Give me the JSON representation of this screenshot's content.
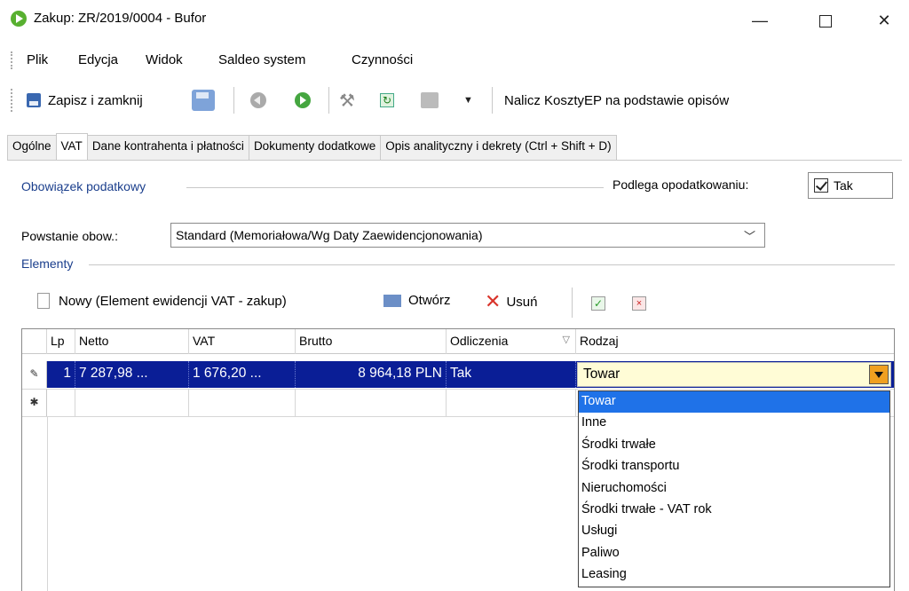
{
  "window": {
    "title": "Zakup: ZR/2019/0004 - Bufor",
    "minimize_glyph": "—",
    "close_glyph": "✕"
  },
  "menu": [
    "Plik",
    "Edycja",
    "Widok",
    "Saldeo system",
    "Czynności"
  ],
  "toolbar": {
    "save_close_label": "Zapisz i zamknij",
    "calc_label": "Nalicz KosztyEP na podstawie opisów",
    "dropdown_glyph": "▼",
    "refresh_glyph": "↻",
    "tools_glyph": "⚒"
  },
  "tabs": [
    "Ogólne",
    "VAT",
    "Dane kontrahenta i płatności",
    "Dokumenty dodatkowe",
    "Opis analityczny i dekrety (Ctrl + Shift + D)"
  ],
  "vat": {
    "obligation_section": "Obowiązek podatkowy",
    "taxable_label": "Podlega opodatkowaniu:",
    "taxable_value": "Tak",
    "origin_label": "Powstanie obow.:",
    "origin_value": "Standard (Memoriałowa/Wg Daty Zaewidencjonowania)",
    "combo_glyph": "﹀",
    "elements_section": "Elementy"
  },
  "elements_toolbar": {
    "new_label": "Nowy (Element ewidencji VAT - zakup)",
    "open_label": "Otwórz",
    "delete_label": "Usuń",
    "delete_glyph": "✕",
    "check_glyph": "✓",
    "x_glyph": "×"
  },
  "grid": {
    "columns": [
      "Lp",
      "Netto",
      "VAT",
      "Brutto",
      "Odliczenia",
      "Rodzaj"
    ],
    "filter_glyph": "▽",
    "rows": [
      {
        "marker": "✎",
        "lp": "1",
        "netto": "7 287,98 ...",
        "vat": "1 676,20 ...",
        "brutto": "8 964,18 PLN",
        "odliczenia": "Tak",
        "rodzaj": "Towar"
      }
    ],
    "new_row_marker": "✱"
  },
  "rodzaj_options": [
    "Towar",
    "Inne",
    "Środki trwałe",
    "Środki transportu",
    "Nieruchomości",
    "Środki trwałe - VAT rok",
    "Usługi",
    "Paliwo",
    "Leasing"
  ],
  "rodzaj_selected_index": 0,
  "colors": {
    "selected_row": "#0a1e96",
    "dropdown_highlight": "#1f72e8",
    "section_label": "#1a3e8c"
  }
}
